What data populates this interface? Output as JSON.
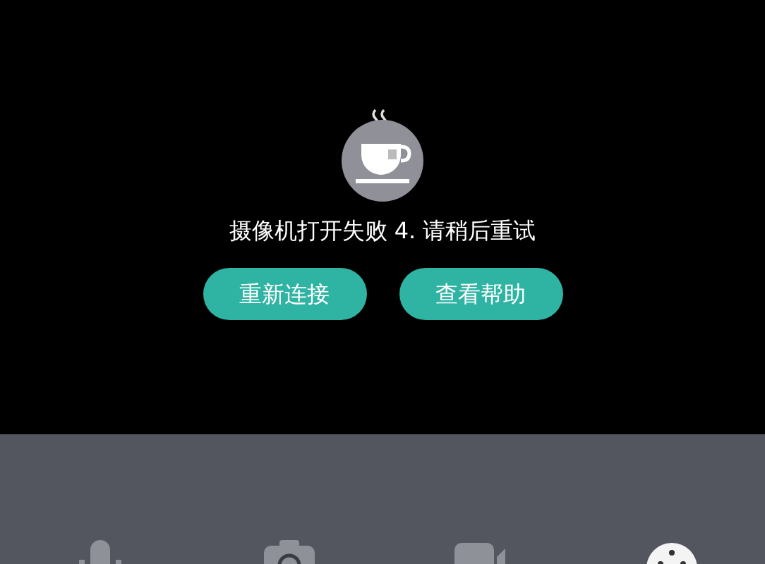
{
  "error": {
    "message": "摄像机打开失败 4. 请稍后重试"
  },
  "buttons": [
    {
      "label": "重新连接"
    },
    {
      "label": "查看帮助"
    }
  ],
  "toolbar": [
    {
      "kind": "microphone",
      "selected": false
    },
    {
      "kind": "camera",
      "selected": false
    },
    {
      "kind": "video",
      "selected": false
    },
    {
      "kind": "more",
      "selected": true
    }
  ]
}
